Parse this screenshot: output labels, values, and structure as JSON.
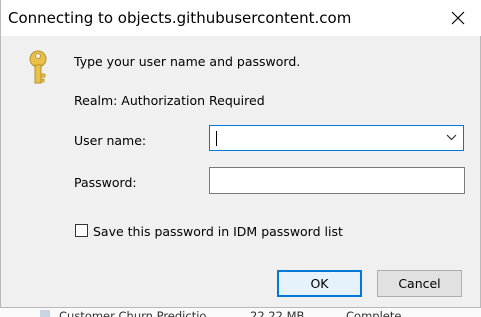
{
  "window": {
    "title": "Connecting to objects.githubusercontent.com",
    "close_icon": "close-icon"
  },
  "dialog": {
    "prompt": "Type your user name and password.",
    "realm": "Realm: Authorization Required",
    "username_label": "User name:",
    "username_value": "",
    "password_label": "Password:",
    "password_value": "",
    "save_label": "Save this password in IDM password list",
    "save_checked": false,
    "key_icon": "key-icon"
  },
  "buttons": {
    "ok": "OK",
    "cancel": "Cancel"
  },
  "background_row": {
    "name": "Customer Churn Predictio",
    "size": "22.22  MB",
    "status": "Complete"
  },
  "colors": {
    "accent": "#0078d7",
    "dialog_bg": "#f0f0f0",
    "key_gold": "#e8c04a"
  }
}
